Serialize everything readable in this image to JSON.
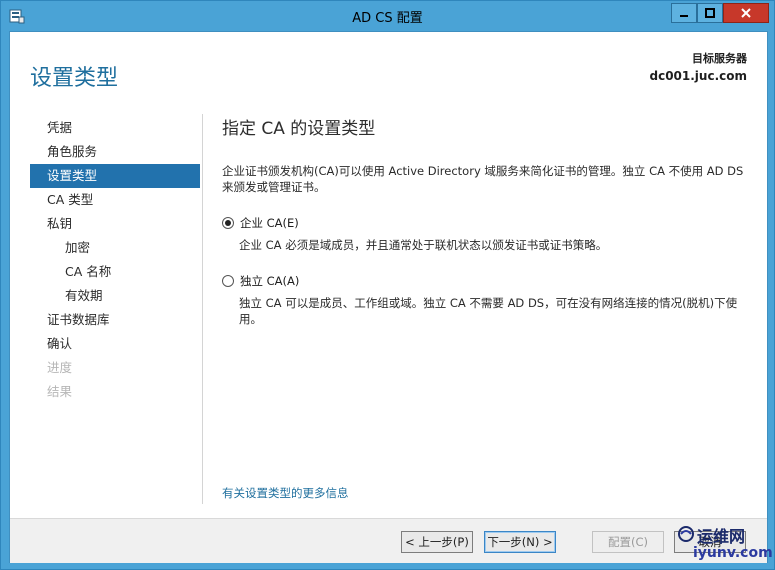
{
  "window": {
    "title": "AD CS 配置",
    "accent": "#4aa3d6",
    "close_color": "#c7382a",
    "icons": {
      "app": "server-tool-icon",
      "minimize": "minimize-icon",
      "maximize": "maximize-icon",
      "close": "close-icon"
    }
  },
  "header": {
    "page_title": "设置类型",
    "target_label": "目标服务器",
    "target_value": "dc001.juc.com"
  },
  "nav": {
    "items": [
      {
        "label": "凭据",
        "state": "normal"
      },
      {
        "label": "角色服务",
        "state": "normal"
      },
      {
        "label": "设置类型",
        "state": "active"
      },
      {
        "label": "CA 类型",
        "state": "normal"
      },
      {
        "label": "私钥",
        "state": "normal"
      },
      {
        "label": "加密",
        "state": "sub"
      },
      {
        "label": "CA 名称",
        "state": "sub"
      },
      {
        "label": "有效期",
        "state": "sub"
      },
      {
        "label": "证书数据库",
        "state": "normal"
      },
      {
        "label": "确认",
        "state": "normal"
      },
      {
        "label": "进度",
        "state": "disabled"
      },
      {
        "label": "结果",
        "state": "disabled"
      }
    ]
  },
  "content": {
    "section_title": "指定 CA 的设置类型",
    "intro": "企业证书颁发机构(CA)可以使用 Active Directory 域服务来简化证书的管理。独立 CA 不使用 AD DS 来颁发或管理证书。",
    "options": [
      {
        "label": "企业 CA(E)",
        "checked": true,
        "description": "企业 CA 必须是域成员，并且通常处于联机状态以颁发证书或证书策略。"
      },
      {
        "label": "独立 CA(A)",
        "checked": false,
        "description": "独立 CA 可以是成员、工作组或域。独立 CA 不需要 AD DS，可在没有网络连接的情况(脱机)下使用。"
      }
    ],
    "more_info_link": "有关设置类型的更多信息"
  },
  "footer": {
    "prev_label": "< 上一步(P)",
    "next_label": "下一步(N) >",
    "configure_label": "配置(C)",
    "cancel_label": "取消"
  },
  "watermark": {
    "top": "运维网",
    "bottom": "iyunv.com"
  }
}
